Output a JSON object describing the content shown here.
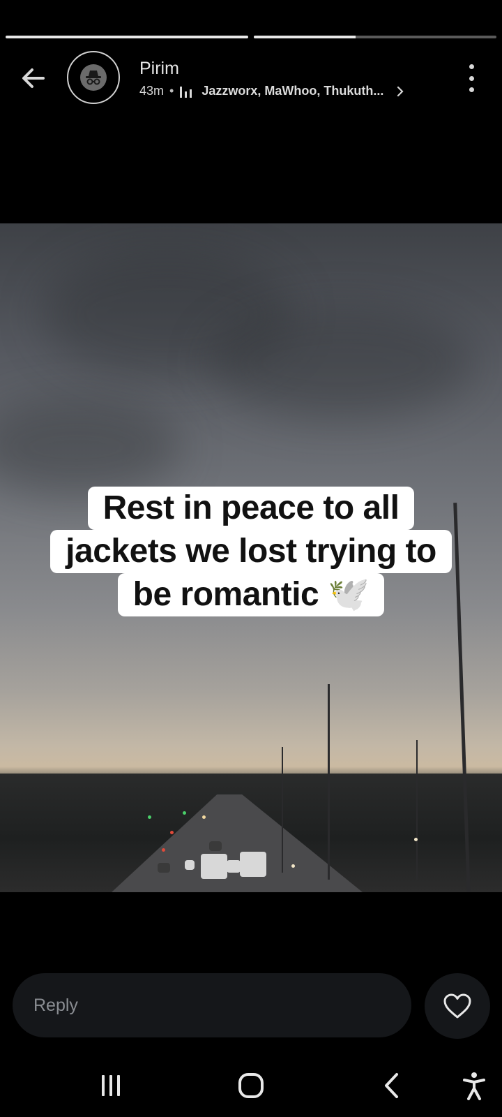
{
  "story": {
    "progress": [
      {
        "segment": 1,
        "fill": 1.0
      },
      {
        "segment": 2,
        "fill": 0.42
      }
    ]
  },
  "header": {
    "username": "Pirim",
    "time_ago": "43m",
    "separator": "•",
    "music_text": "Jazzworx, MaWhoo, Thukuth..."
  },
  "caption": {
    "line1": "Rest in peace to all",
    "line2": "jackets we lost trying to",
    "line3": "be romantic 🕊️"
  },
  "reply": {
    "placeholder": "Reply"
  },
  "icons": {
    "back": "arrow-left-icon",
    "avatar": "incognito-avatar",
    "music": "music-bars-icon",
    "chevron": "chevron-right-icon",
    "more": "more-vertical-icon",
    "like": "heart-icon",
    "recents": "recents-icon",
    "home": "home-icon",
    "nav_back": "back-chevron-icon",
    "accessibility": "accessibility-icon"
  },
  "colors": {
    "background": "#000000",
    "reply_bg": "#15171a",
    "caption_bg": "#ffffff",
    "caption_text": "#111111"
  }
}
